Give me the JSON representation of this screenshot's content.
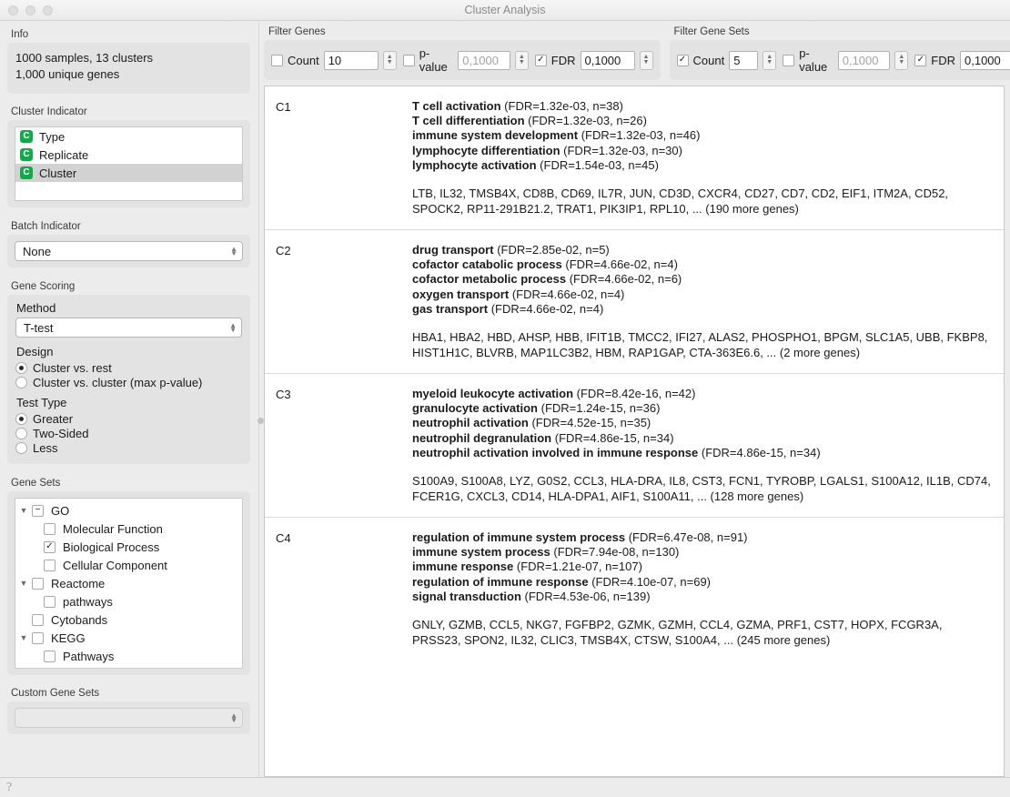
{
  "window": {
    "title": "Cluster Analysis",
    "traffic_lights": [
      "close-button",
      "minimize-button",
      "zoom-button"
    ]
  },
  "sidebar": {
    "info": {
      "label": "Info",
      "line1": "1000 samples, 13 clusters",
      "line2": "1,000 unique genes"
    },
    "cluster_indicator": {
      "label": "Cluster Indicator",
      "items": [
        {
          "label": "Type",
          "badge": "C",
          "selected": false
        },
        {
          "label": "Replicate",
          "badge": "C",
          "selected": false
        },
        {
          "label": "Cluster",
          "badge": "C",
          "selected": true
        }
      ]
    },
    "batch_indicator": {
      "label": "Batch Indicator",
      "value": "None"
    },
    "gene_scoring": {
      "label": "Gene Scoring",
      "method_label": "Method",
      "method_value": "T-test",
      "design_label": "Design",
      "design_options": [
        {
          "label": "Cluster vs. rest",
          "selected": true
        },
        {
          "label": "Cluster vs. cluster (max p-value)",
          "selected": false
        }
      ],
      "test_type_label": "Test Type",
      "test_type_options": [
        {
          "label": "Greater",
          "selected": true
        },
        {
          "label": "Two-Sided",
          "selected": false
        },
        {
          "label": "Less",
          "selected": false
        }
      ]
    },
    "gene_sets": {
      "label": "Gene Sets",
      "tree": [
        {
          "label": "GO",
          "indent": 0,
          "twisty": "down",
          "check": "partial"
        },
        {
          "label": "Molecular Function",
          "indent": 1,
          "twisty": "",
          "check": "off"
        },
        {
          "label": "Biological Process",
          "indent": 1,
          "twisty": "",
          "check": "on"
        },
        {
          "label": "Cellular Component",
          "indent": 1,
          "twisty": "",
          "check": "off"
        },
        {
          "label": "Reactome",
          "indent": 0,
          "twisty": "down",
          "check": "off"
        },
        {
          "label": "pathways",
          "indent": 1,
          "twisty": "",
          "check": "off"
        },
        {
          "label": "Cytobands",
          "indent": 0,
          "twisty": "",
          "check": "off"
        },
        {
          "label": "KEGG",
          "indent": 0,
          "twisty": "down",
          "check": "off"
        },
        {
          "label": "Pathways",
          "indent": 1,
          "twisty": "",
          "check": "off"
        }
      ]
    },
    "custom_gene_sets": {
      "label": "Custom Gene Sets",
      "value": ""
    }
  },
  "filters": {
    "genes": {
      "label": "Filter Genes",
      "count": {
        "label": "Count",
        "checked": false,
        "value": "10",
        "is_placeholder": false
      },
      "pvalue": {
        "label": "p-value",
        "checked": false,
        "value": "0,1000",
        "is_placeholder": true
      },
      "fdr": {
        "label": "FDR",
        "checked": true,
        "value": "0,1000",
        "is_placeholder": false
      }
    },
    "gene_sets": {
      "label": "Filter Gene Sets",
      "count": {
        "label": "Count",
        "checked": true,
        "value": "5",
        "is_placeholder": false
      },
      "pvalue": {
        "label": "p-value",
        "checked": false,
        "value": "0,1000",
        "is_placeholder": true
      },
      "fdr": {
        "label": "FDR",
        "checked": true,
        "value": "0,1000",
        "is_placeholder": false
      }
    }
  },
  "clusters": [
    {
      "name": "C1",
      "gene_sets": [
        {
          "name": "T cell activation",
          "stat": "(FDR=1.32e-03, n=38)"
        },
        {
          "name": "T cell differentiation",
          "stat": "(FDR=1.32e-03, n=26)"
        },
        {
          "name": "immune system development",
          "stat": "(FDR=1.32e-03, n=46)"
        },
        {
          "name": "lymphocyte differentiation",
          "stat": "(FDR=1.32e-03, n=30)"
        },
        {
          "name": "lymphocyte activation",
          "stat": "(FDR=1.54e-03, n=45)"
        }
      ],
      "genes": "LTB, IL32, TMSB4X, CD8B, CD69, IL7R, JUN, CD3D, CXCR4, CD27, CD7, CD2, EIF1, ITM2A, CD52, SPOCK2, RP11-291B21.2, TRAT1, PIK3IP1, RPL10, ... (190 more genes)"
    },
    {
      "name": "C2",
      "gene_sets": [
        {
          "name": "drug transport",
          "stat": "(FDR=2.85e-02, n=5)"
        },
        {
          "name": "cofactor catabolic process",
          "stat": "(FDR=4.66e-02, n=4)"
        },
        {
          "name": "cofactor metabolic process",
          "stat": "(FDR=4.66e-02, n=6)"
        },
        {
          "name": "oxygen transport",
          "stat": "(FDR=4.66e-02, n=4)"
        },
        {
          "name": "gas transport",
          "stat": "(FDR=4.66e-02, n=4)"
        }
      ],
      "genes": "HBA1, HBA2, HBD, AHSP, HBB, IFIT1B, TMCC2, IFI27, ALAS2, PHOSPHO1, BPGM, SLC1A5, UBB, FKBP8, HIST1H1C, BLVRB, MAP1LC3B2, HBM, RAP1GAP, CTA-363E6.6, ... (2 more genes)"
    },
    {
      "name": "C3",
      "gene_sets": [
        {
          "name": "myeloid leukocyte activation",
          "stat": "(FDR=8.42e-16, n=42)"
        },
        {
          "name": "granulocyte activation",
          "stat": "(FDR=1.24e-15, n=36)"
        },
        {
          "name": "neutrophil activation",
          "stat": "(FDR=4.52e-15, n=35)"
        },
        {
          "name": "neutrophil degranulation",
          "stat": "(FDR=4.86e-15, n=34)"
        },
        {
          "name": "neutrophil activation involved in immune response",
          "stat": "(FDR=4.86e-15, n=34)"
        }
      ],
      "genes": "S100A9, S100A8, LYZ, G0S2, CCL3, HLA-DRA, IL8, CST3, FCN1, TYROBP, LGALS1, S100A12, IL1B, CD74, FCER1G, CXCL3, CD14, HLA-DPA1, AIF1, S100A11, ... (128 more genes)"
    },
    {
      "name": "C4",
      "gene_sets": [
        {
          "name": "regulation of immune system process",
          "stat": "(FDR=6.47e-08, n=91)"
        },
        {
          "name": "immune system process",
          "stat": "(FDR=7.94e-08, n=130)"
        },
        {
          "name": "immune response",
          "stat": "(FDR=1.21e-07, n=107)"
        },
        {
          "name": "regulation of immune response",
          "stat": "(FDR=4.10e-07, n=69)"
        },
        {
          "name": "signal transduction",
          "stat": "(FDR=4.53e-06, n=139)"
        }
      ],
      "genes": "GNLY, GZMB, CCL5, NKG7, FGFBP2, GZMK, GZMH, CCL4, GZMA, PRF1, CST7, HOPX, FCGR3A, PRSS23, SPON2, IL32, CLIC3, TMSB4X, CTSW, S100A4, ... (245 more genes)"
    }
  ],
  "statusbar": {
    "help_icon": "question-mark-icon"
  },
  "colors": {
    "badge_green": "#15a84b",
    "selection_gray": "#d2d2d2",
    "panel_gray": "#e3e3e3"
  }
}
